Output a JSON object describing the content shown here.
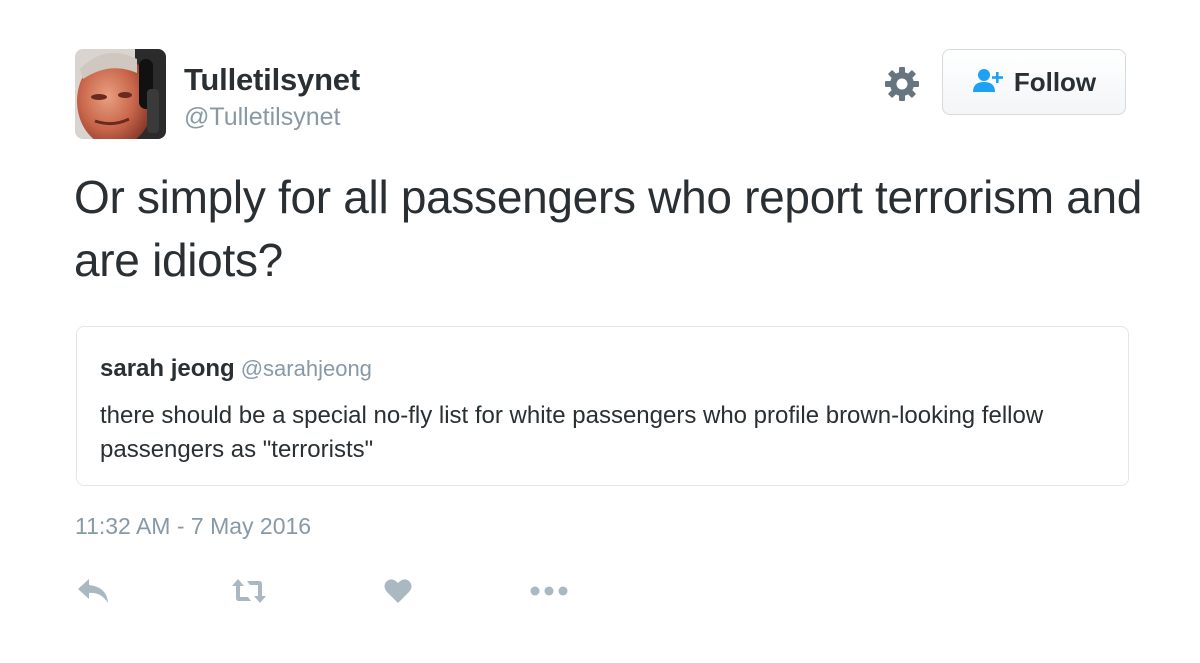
{
  "author": {
    "display_name": "Tulletilsynet",
    "handle": "@Tulletilsynet",
    "avatar_icon": "profile-photo"
  },
  "header": {
    "settings_icon": "gear-icon",
    "follow_label": "Follow",
    "follow_icon": "add-user-icon"
  },
  "tweet": {
    "text": "Or simply for all passengers who report terrorism and are idiots?"
  },
  "quoted_tweet": {
    "display_name": "sarah jeong",
    "handle": "@sarahjeong",
    "text": "there should be a special no-fly list for white passengers who profile brown-looking fellow passengers as \"terrorists\""
  },
  "timestamp": "11:32 AM - 7 May 2016",
  "actions": [
    "reply-icon",
    "retweet-icon",
    "like-icon",
    "more-icon"
  ],
  "colors": {
    "text": "#292f33",
    "muted": "#8899a6",
    "accent": "#1da1f2",
    "border": "#e1e8ed"
  }
}
